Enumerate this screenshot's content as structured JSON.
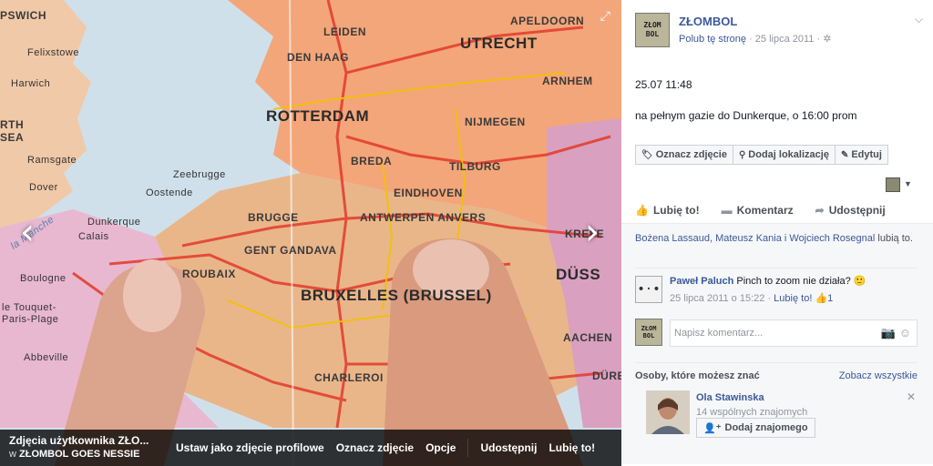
{
  "photo": {
    "map_labels": {
      "ipswich": "PSWICH",
      "felixstowe": "Felixstowe",
      "harwich": "Harwich",
      "north_sea": "RTH\nSEA",
      "ramsgate": "Ramsgate",
      "dover": "Dover",
      "dunkerque": "Dunkerque",
      "calais": "Calais",
      "boulogne": "Boulogne",
      "le_touquet": "le Touquet-\nParis-Plage",
      "abbeville": "Abbeville",
      "leiden": "LEIDEN",
      "den_haag": "DEN HAAG",
      "rotterdam": "ROTTERDAM",
      "zeebrugge": "Zeebrugge",
      "oostende": "Oostende",
      "brugge": "BRUGGE",
      "gent": "GENT\nGANDAVA",
      "roubaix": "ROUBAIX",
      "utrecht": "UTRECHT",
      "apeldoorn": "APELDOORN",
      "arnhem": "ARNHEM",
      "nijmegen": "NIJMEGEN",
      "breda": "BREDA",
      "tilburg": "TILBURG",
      "eindhoven": "EINDHOVEN",
      "antwerpen": "ANTWERPEN\nANVERS",
      "bruxelles": "BRUXELLES\n(BRUSSEL)",
      "charleroi": "CHARLEROI",
      "krefeld": "KREFE",
      "dusseldorf": "DÜSS",
      "aachen": "AACHEN",
      "duren": "DÜREN",
      "la_manche": "la Manche"
    },
    "album_title": "Zdjęcia użytkownika ZŁO...",
    "album_sub_prefix": "w",
    "album_sub_name": "ZŁOMBOL GOES NESSIE",
    "actions": {
      "profile": "Ustaw jako zdjęcie profilowe",
      "tag": "Oznacz zdjęcie",
      "options": "Opcje",
      "share": "Udostępnij",
      "like": "Lubię to!"
    }
  },
  "panel": {
    "page_name": "ZŁOMBOL",
    "logo_text": [
      "ZŁOM",
      "BOL"
    ],
    "like_page": "Polub tę stronę",
    "date": "25 lipca 2011",
    "meta_sep": "·",
    "caption_time": "25.07 11:48",
    "caption_text": "na pełnym gazie do Dunkerque, o 16:00 prom",
    "buttons": {
      "tag": "Oznacz zdjęcie",
      "location": "Dodaj lokalizację",
      "edit": "Edytuj"
    },
    "ufi": {
      "like": "Lubię to!",
      "comment": "Komentarz",
      "share": "Udostępnij"
    },
    "likers": {
      "names": "Bożena Lassaud, Mateusz Kania i Wojciech Rosegnal",
      "suffix": "lubią to."
    },
    "comment": {
      "author": "Paweł Paluch",
      "text": "Pinch to zoom nie działa? 🙂",
      "avatar_text": "•·•",
      "date": "25 lipca 2011 o 15:22",
      "like_link": "Lubię to!",
      "like_count": "1"
    },
    "reply_placeholder": "Napisz komentarz...",
    "pymk": {
      "title": "Osoby, które możesz znać",
      "see_all": "Zobacz wszystkie",
      "name": "Ola Stawinska",
      "mutual": "14 wspólnych znajomych",
      "add": "Dodaj znajomego"
    }
  },
  "colors": {
    "link": "#3b5998",
    "muted": "#90949c",
    "ufi_bg": "#f6f7f9"
  }
}
